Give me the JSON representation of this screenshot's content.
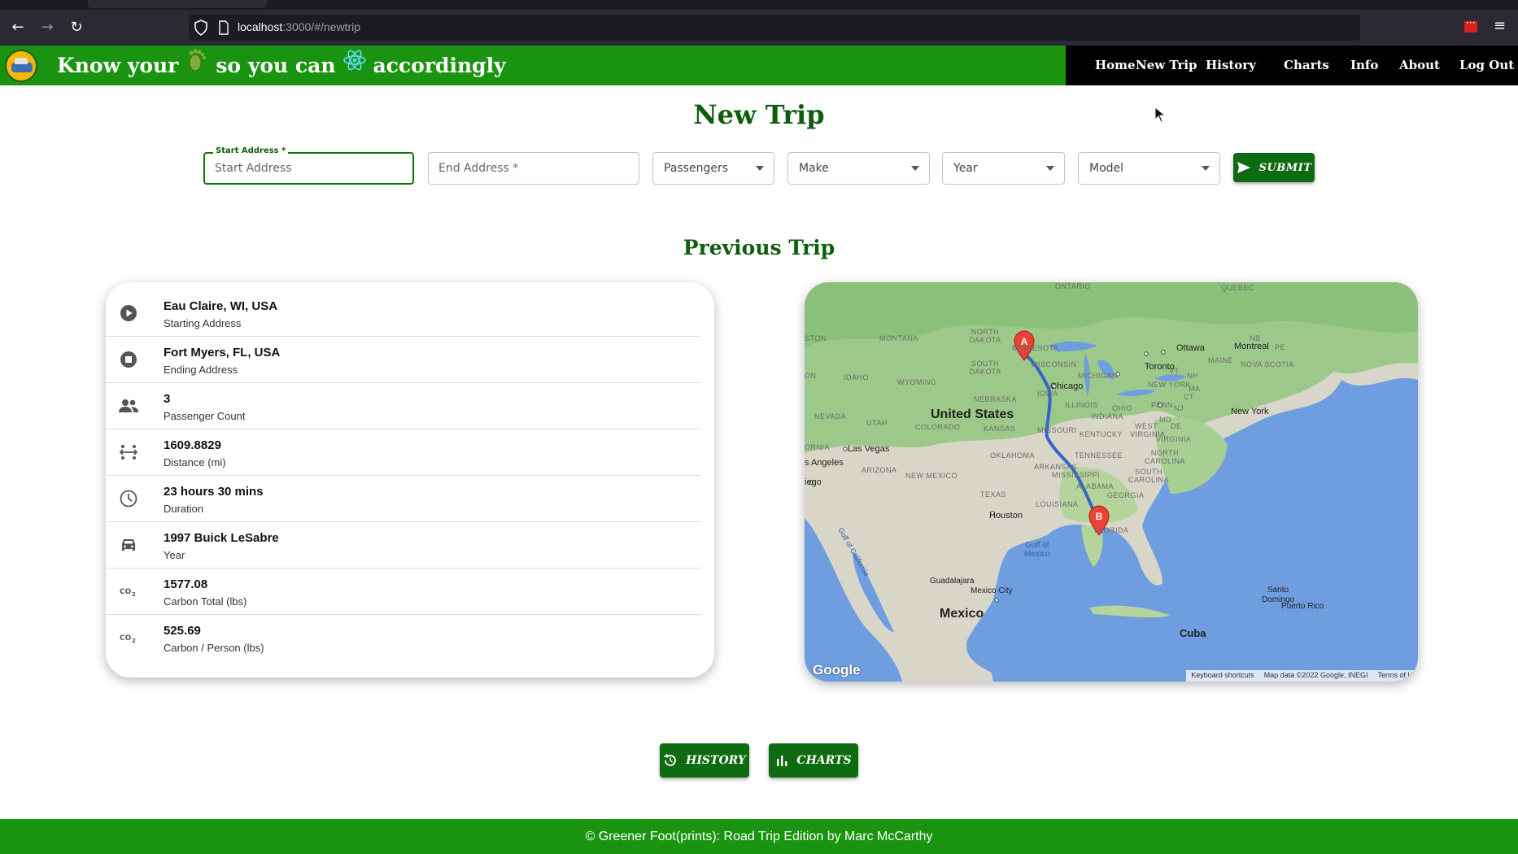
{
  "browser": {
    "url_host": "localhost",
    "url_rest": ":3000/#/newtrip"
  },
  "header": {
    "tagline_part1": "Know your",
    "tagline_part2": "so you can",
    "tagline_part3": "accordingly",
    "nav": [
      "Home",
      "New Trip",
      "History",
      "Charts",
      "Info",
      "About",
      "Log Out"
    ]
  },
  "page_title": "New Trip",
  "form": {
    "start_label": "Start Address *",
    "start_placeholder": "Start Address",
    "end_placeholder": "End Address *",
    "passengers": "Passengers",
    "make": "Make",
    "year": "Year",
    "model": "Model",
    "submit": "SUBMIT"
  },
  "previous_trip_title": "Previous Trip",
  "trip": [
    {
      "icon": "play-circle-icon",
      "primary": "Eau Claire, WI, USA",
      "secondary": "Starting Address"
    },
    {
      "icon": "stop-circle-icon",
      "primary": "Fort Myers, FL, USA",
      "secondary": "Ending Address"
    },
    {
      "icon": "people-icon",
      "primary": "3",
      "secondary": "Passenger Count"
    },
    {
      "icon": "distance-icon",
      "primary": "1609.8829",
      "secondary": "Distance (mi)"
    },
    {
      "icon": "clock-icon",
      "primary": "23 hours 30 mins",
      "secondary": "Duration"
    },
    {
      "icon": "car-icon",
      "primary": "1997 Buick LeSabre",
      "secondary": "Year"
    },
    {
      "icon": "co2-icon",
      "primary": "1577.08",
      "secondary": "Carbon Total (lbs)"
    },
    {
      "icon": "co2-icon",
      "primary": "525.69",
      "secondary": "Carbon / Person (lbs)"
    }
  ],
  "map": {
    "marker_a": "A",
    "marker_b": "B",
    "google": "Google",
    "footer": [
      "Keyboard shortcuts",
      "Map data ©2022 Google, INEGI",
      "Terms of U"
    ],
    "labels": {
      "ontario": "ONTARIO",
      "quebec": "QUEBEC",
      "montana": "MONTANA",
      "north_dakota": "NORTH DAKOTA",
      "minnesota": "MINNESOTA",
      "south_dakota": "SOUTH DAKOTA",
      "wisconsin": "WISCONSIN",
      "michigan": "MICHIGAN",
      "idaho": "IDAHO",
      "wyoming": "WYOMING",
      "nebraska": "NEBRASKA",
      "iowa": "IOWA",
      "illinois": "ILLINOIS",
      "indiana": "INDIANA",
      "ohio": "OHIO",
      "penn": "PENN",
      "new_york_state": "NEW YORK",
      "maine": "MAINE",
      "nova_scotia": "NOVA SCOTIA",
      "nevada": "NEVADA",
      "utah": "UTAH",
      "colorado": "COLORADO",
      "kansas": "KANSAS",
      "missouri": "MISSOURI",
      "kentucky": "KENTUCKY",
      "west_virginia": "WEST VIRGINIA",
      "virginia": "VIRGINIA",
      "tennessee": "TENNESSEE",
      "north_carolina": "NORTH CAROLINA",
      "south_carolina": "SOUTH CAROLINA",
      "oklahoma": "OKLAHOMA",
      "arkansas": "ARKANSAS",
      "mississippi": "MISSISSIPPI",
      "alabama": "ALABAMA",
      "georgia": "GEORGIA",
      "arizona": "ARIZONA",
      "new_mexico": "NEW MEXICO",
      "texas": "TEXAS",
      "louisiana": "LOUISIANA",
      "florida": "FLORIDA",
      "fornia": "ORNIA",
      "ston": "STON",
      "on": "ON",
      "nb": "NB",
      "pe": "PE",
      "vt": "VT",
      "nh": "NH",
      "ma": "MA",
      "ct": "CT",
      "nj": "NJ",
      "md": "MD",
      "de": "DE",
      "united_states": "United States",
      "mexico": "Mexico",
      "cuba": "Cuba",
      "chicago": "Chicago",
      "toronto": "Toronto",
      "ottawa": "Ottawa",
      "montreal": "Montreal",
      "new_york": "New York",
      "las_vegas": "Las Vegas",
      "los_angeles": "s Angeles",
      "san_diego": "iego",
      "houston": "Houston",
      "guadalajara": "Guadalajara",
      "mexico_city": "Mexico City",
      "santo_domingo": "Santo\nDomingo",
      "puerto_rico": "Puerto Rico",
      "gulf_of_mexico": "Gulf of\nMexico",
      "gulf_of_california": "Gulf of California"
    }
  },
  "buttons": {
    "history": "HISTORY",
    "charts": "CHARTS"
  },
  "footer": "© Greener Foot(prints): Road Trip Edition by Marc McCarthy"
}
